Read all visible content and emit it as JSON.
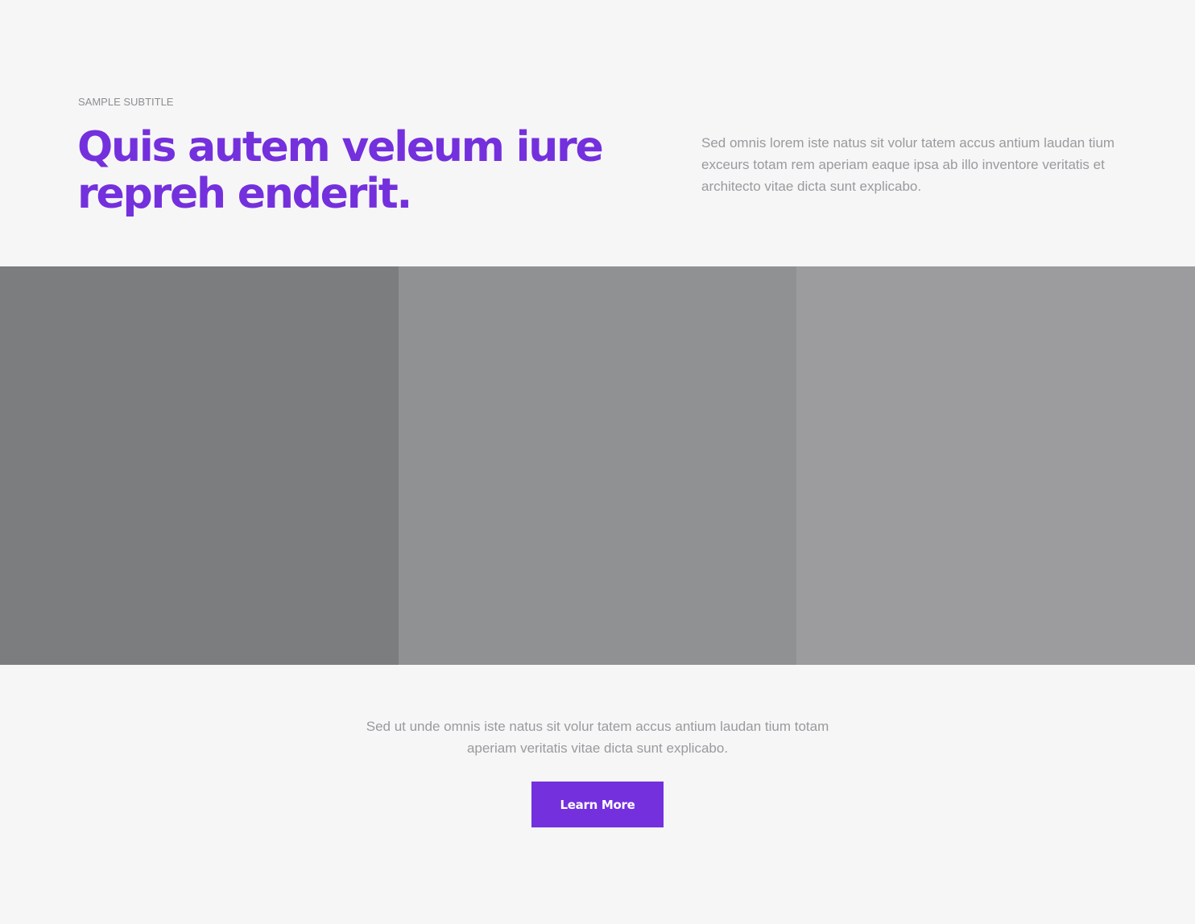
{
  "hero": {
    "subtitle": "SAMPLE SUBTITLE",
    "heading_line1": "Quis autem veleum iure",
    "heading_line2": "repreh enderit.",
    "description": "Sed omnis lorem iste natus sit volur tatem accus antium laudan tium exceurs totam rem aperiam eaque ipsa ab illo inventore veritatis et architecto vitae dicta sunt explicabo."
  },
  "gallery": {
    "tiles": [
      {
        "color": "#7c7d7f"
      },
      {
        "color": "#909193"
      },
      {
        "color": "#9c9c9e"
      }
    ]
  },
  "cta": {
    "text": "Sed ut unde omnis iste natus sit volur tatem accus antium laudan tium totam aperiam veritatis vitae dicta sunt explicabo.",
    "button_label": "Learn More"
  },
  "colors": {
    "accent": "#7430dd",
    "background": "#f6f6f6",
    "muted_text": "#9a9a9f"
  }
}
